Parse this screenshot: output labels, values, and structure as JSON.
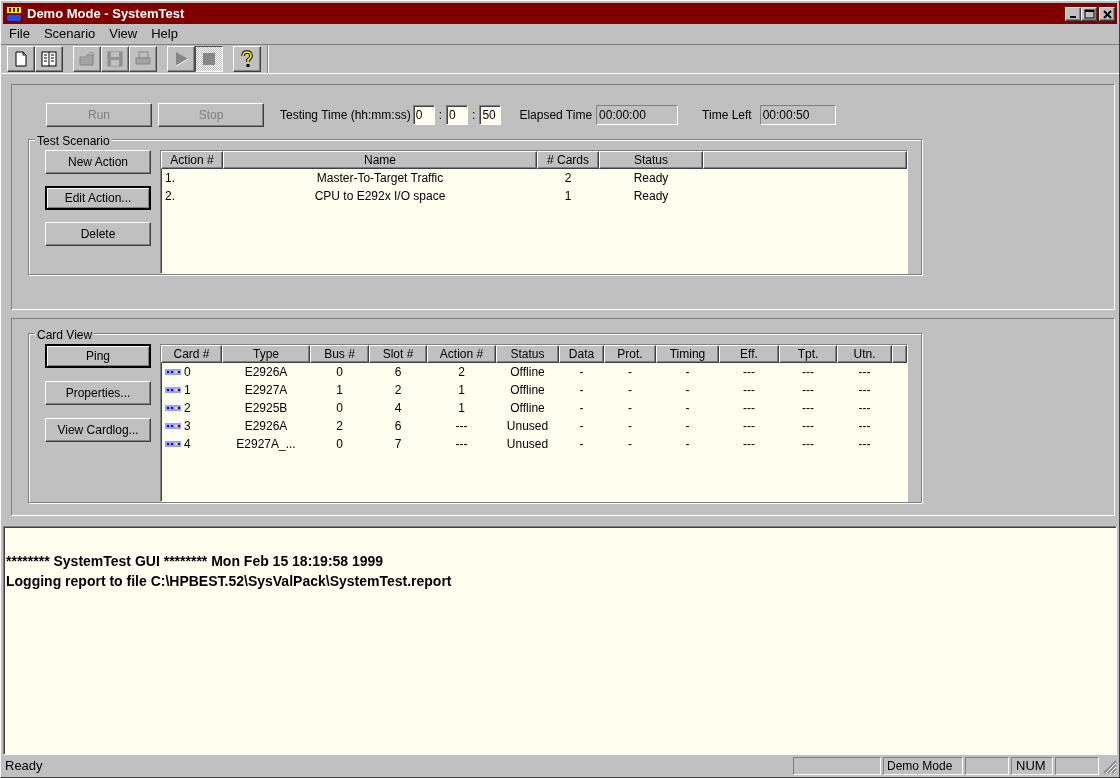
{
  "window": {
    "title": "Demo Mode - SystemTest"
  },
  "menu": [
    "File",
    "Scenario",
    "View",
    "Help"
  ],
  "toolbar": [
    {
      "kind": "new",
      "disabled": false,
      "pressed": false
    },
    {
      "kind": "columns",
      "disabled": false,
      "pressed": false
    },
    {
      "kind": "open",
      "disabled": true,
      "pressed": false
    },
    {
      "kind": "save",
      "disabled": true,
      "pressed": false
    },
    {
      "kind": "print",
      "disabled": true,
      "pressed": false
    },
    {
      "kind": "play",
      "disabled": true,
      "pressed": false
    },
    {
      "kind": "stop",
      "disabled": true,
      "pressed": true
    },
    {
      "kind": "help",
      "disabled": false,
      "pressed": false
    }
  ],
  "run_controls": {
    "buttons": [
      {
        "label": "Run",
        "disabled": true
      },
      {
        "label": "Stop",
        "disabled": true
      }
    ],
    "testing_time": {
      "label": "Testing Time (hh:mm:ss)",
      "hours": "0",
      "minutes": "0",
      "seconds": "50",
      "separator": ":"
    },
    "elapsed_time": {
      "label": "Elapsed Time",
      "value": "00:00:00"
    },
    "time_left": {
      "label": "Time Left",
      "value": "00:00:50"
    }
  },
  "test_scenario": {
    "title": "Test Scenario",
    "buttons": [
      {
        "label": "New Action",
        "default": false
      },
      {
        "label": "Edit Action...",
        "default": true
      },
      {
        "label": "Delete",
        "default": false
      }
    ],
    "columns": [
      "Action #",
      "Name",
      "# Cards",
      "Status"
    ],
    "rows": [
      [
        "1.",
        "Master-To-Target Traffic",
        "2",
        "Ready"
      ],
      [
        "2.",
        "CPU to E292x I/O space",
        "1",
        "Ready"
      ]
    ]
  },
  "card_view": {
    "title": "Card View",
    "buttons": [
      {
        "label": "Ping",
        "default": true
      },
      {
        "label": "Properties...",
        "default": false
      },
      {
        "label": "View Cardlog...",
        "default": false
      }
    ],
    "columns": [
      "Card #",
      "Type",
      "Bus #",
      "Slot #",
      "Action #",
      "Status",
      "Data",
      "Prot.",
      "Timing",
      "Eff.",
      "Tpt.",
      "Utn."
    ],
    "rows": [
      [
        "0",
        "E2926A",
        "0",
        "6",
        "2",
        "Offline",
        "-",
        "-",
        "-",
        "---",
        "---",
        "---"
      ],
      [
        "1",
        "E2927A",
        "1",
        "2",
        "1",
        "Offline",
        "-",
        "-",
        "-",
        "---",
        "---",
        "---"
      ],
      [
        "2",
        "E2925B",
        "0",
        "4",
        "1",
        "Offline",
        "-",
        "-",
        "-",
        "---",
        "---",
        "---"
      ],
      [
        "3",
        "E2926A",
        "2",
        "6",
        "---",
        "Unused",
        "-",
        "-",
        "-",
        "---",
        "---",
        "---"
      ],
      [
        "4",
        "E2927A_...",
        "0",
        "7",
        "---",
        "Unused",
        "-",
        "-",
        "-",
        "---",
        "---",
        "---"
      ]
    ]
  },
  "log": [
    "******** SystemTest GUI ******** Mon Feb 15 18:19:58 1999",
    "Logging report to file C:\\HPBEST.52\\SysValPack\\SystemTest.report"
  ],
  "status_bar": {
    "text": "Ready",
    "mode": "Demo Mode",
    "num": "NUM"
  }
}
